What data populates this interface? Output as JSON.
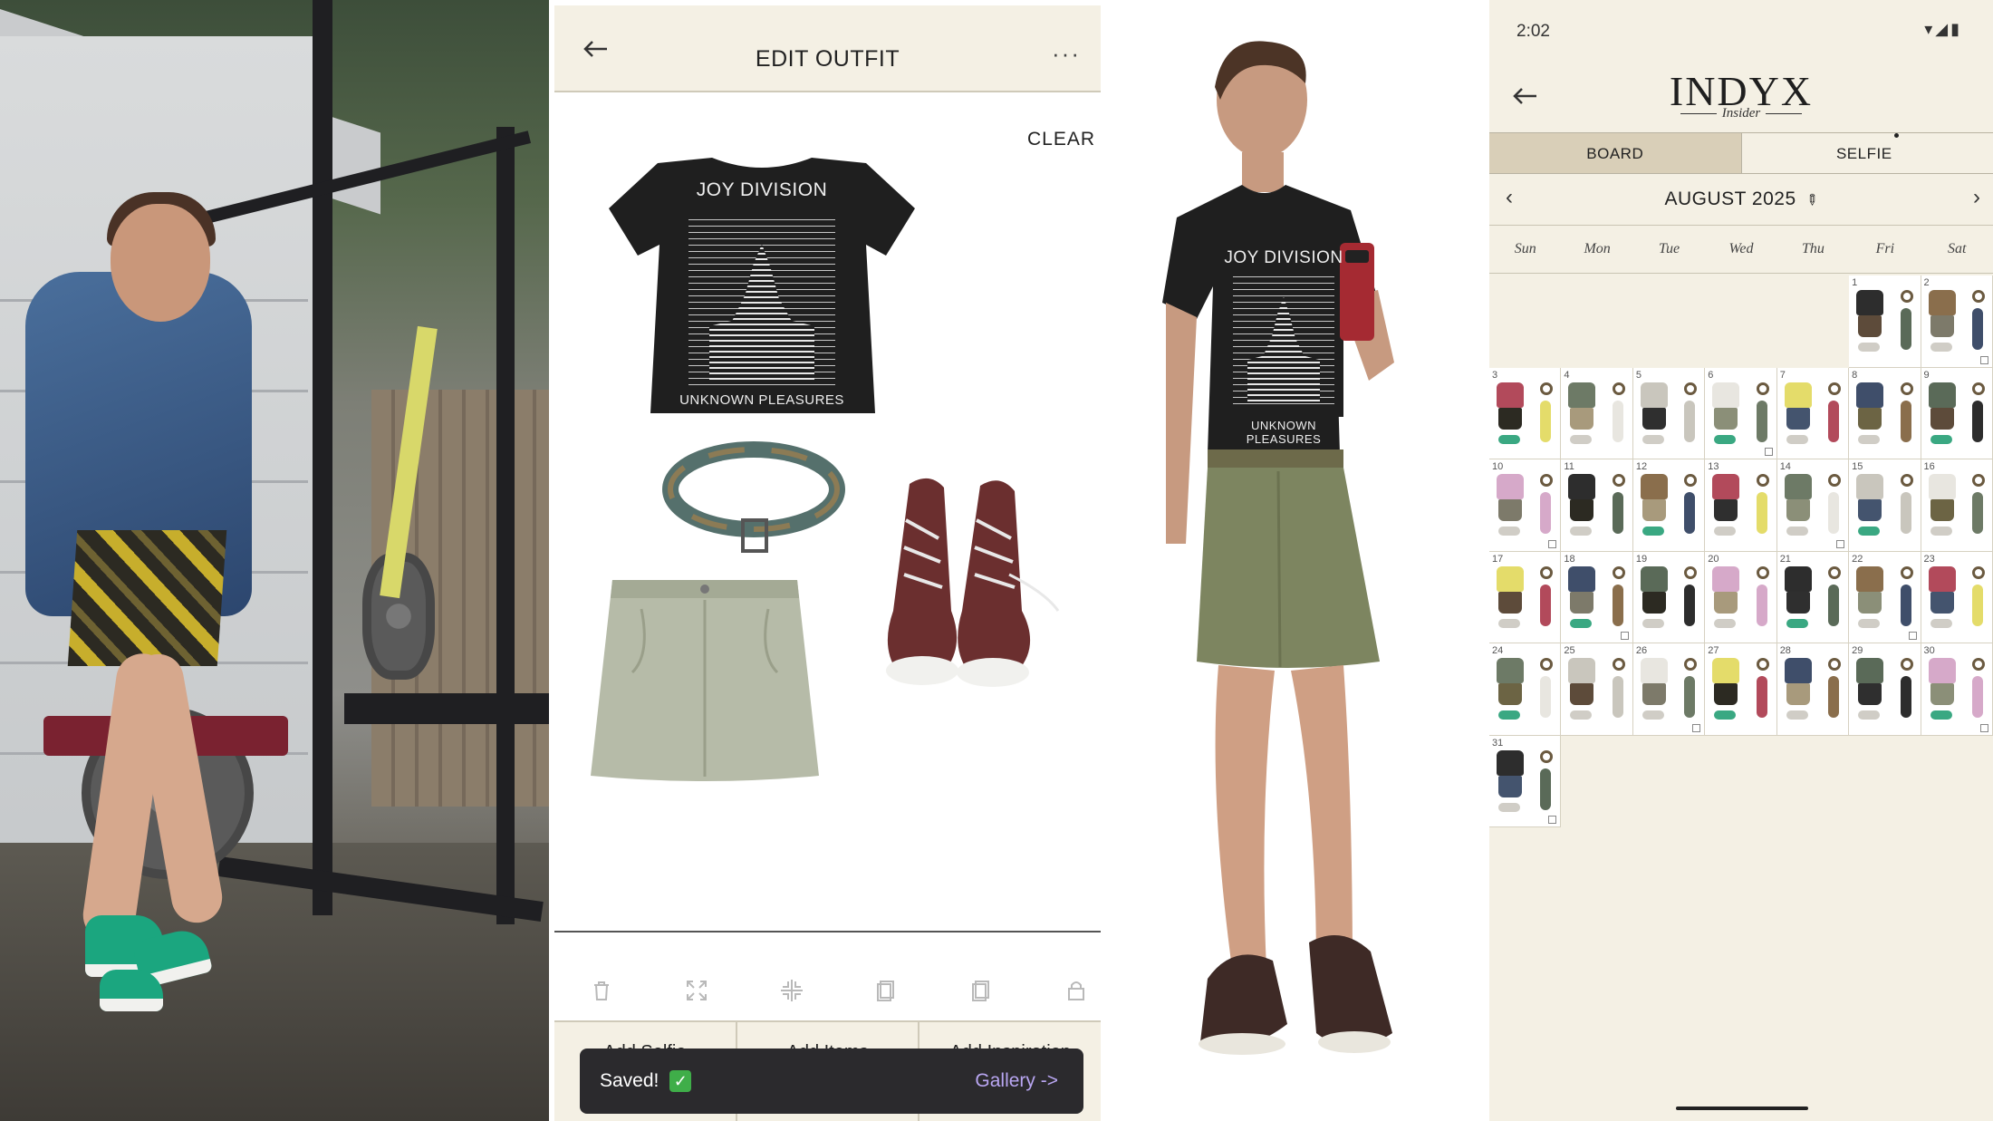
{
  "edit_outfit": {
    "title": "EDIT OUTFIT",
    "back_icon": "arrow-left-icon",
    "more_label": "···",
    "clear_label": "CLEAR",
    "shirt_band": "JOY DIVISION",
    "shirt_album": "UNKNOWN PLEASURES",
    "toolbar_icons": [
      "trash-icon",
      "expand-icon",
      "collapse-icon",
      "send-backward-icon",
      "bring-forward-icon",
      "lock-icon"
    ],
    "bottom_tabs": [
      "Add Selfie",
      "Add Items",
      "Add Inspiration"
    ],
    "toast": {
      "message": "Saved!",
      "check": "✓",
      "link": "Gallery ->"
    }
  },
  "selfie_photo": {
    "shirt_band": "JOY DIVISION",
    "shirt_album": "UNKNOWN PLEASURES"
  },
  "indyx": {
    "status_time": "2:02",
    "logo": "INDYX",
    "logo_sub": "Insider",
    "tabs": {
      "board": "BOARD",
      "selfie": "SELFIE"
    },
    "month_label": "AUGUST 2025",
    "weekdays": [
      "Sun",
      "Mon",
      "Tue",
      "Wed",
      "Thu",
      "Fri",
      "Sat"
    ],
    "first_weekday_index": 5,
    "days_in_month": 31,
    "colors": {
      "accent_tab": "#d9cfb8",
      "background": "#f4f0e4"
    }
  }
}
